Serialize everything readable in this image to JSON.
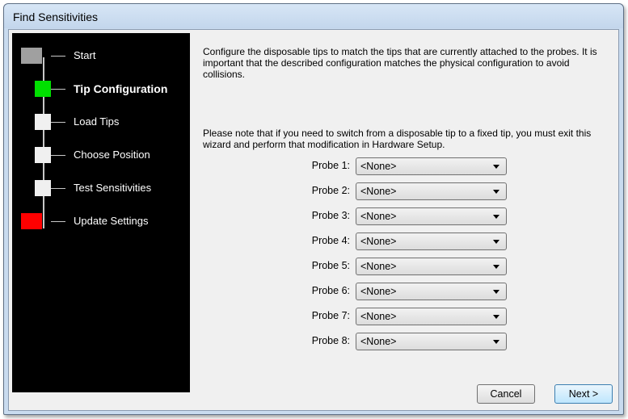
{
  "window": {
    "title": "Find Sensitivities"
  },
  "steps": [
    {
      "label": "Start",
      "status_color": "#a0a0a0"
    },
    {
      "label": "Tip Configuration",
      "status_color": "#00e000"
    },
    {
      "label": "Load Tips",
      "status_color": "#f0f0f0"
    },
    {
      "label": "Choose Position",
      "status_color": "#f0f0f0"
    },
    {
      "label": "Test Sensitivities",
      "status_color": "#f0f0f0"
    },
    {
      "label": "Update Settings",
      "status_color": "#ff0000"
    }
  ],
  "active_step": "Tip Configuration",
  "content": {
    "intro": "Configure the disposable tips to match the tips that are currently attached to the probes.  It is important that the described configuration matches the physical configuration to avoid collisions.",
    "note": "Please note that if you need to switch from a disposable tip to a fixed tip, you must exit this wizard and perform that modification in Hardware Setup."
  },
  "probes": [
    {
      "label": "Probe 1:",
      "value": "<None>"
    },
    {
      "label": "Probe 2:",
      "value": "<None>"
    },
    {
      "label": "Probe 3:",
      "value": "<None>"
    },
    {
      "label": "Probe 4:",
      "value": "<None>"
    },
    {
      "label": "Probe 5:",
      "value": "<None>"
    },
    {
      "label": "Probe 6:",
      "value": "<None>"
    },
    {
      "label": "Probe 7:",
      "value": "<None>"
    },
    {
      "label": "Probe 8:",
      "value": "<None>"
    }
  ],
  "buttons": {
    "cancel": "Cancel",
    "next": "Next >"
  }
}
